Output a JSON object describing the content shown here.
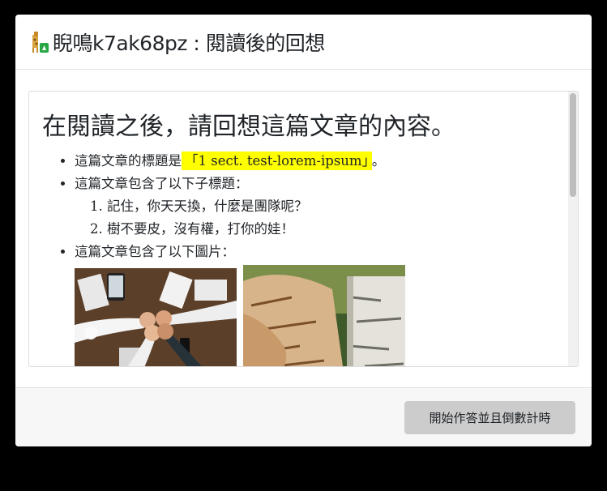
{
  "dialog": {
    "title": "睨鳴k7ak68pz : 閱讀後的回想"
  },
  "content": {
    "heading": "在閱讀之後，請回想這篇文章的內容。",
    "title_prefix": "這篇文章的標題是",
    "title_value": "「1 sect. test-lorem-ipsum」",
    "title_suffix": "。",
    "subheadings_intro": "這篇文章包含了以下子標題：",
    "subheadings": [
      "記住，你天天換，什麼是團隊呢？",
      "樹不要皮，沒有權，打你的娃！"
    ],
    "images_intro": "這篇文章包含了以下圖片："
  },
  "footer": {
    "start_button_label": "開始作答並且倒數計時"
  },
  "colors": {
    "highlight": "#ffff00",
    "button_bg": "#cccccc",
    "backdrop": "#000000"
  }
}
